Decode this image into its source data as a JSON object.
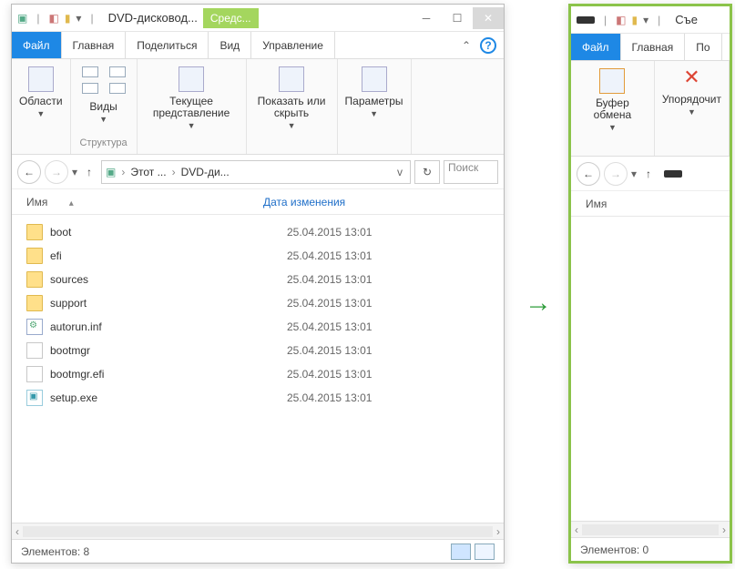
{
  "left": {
    "title": "DVD-дисковод...",
    "context_tab": "Средс...",
    "tabs": {
      "file": "Файл",
      "home": "Главная",
      "share": "Поделиться",
      "view": "Вид",
      "manage": "Управление"
    },
    "ribbon": {
      "panes": "Области",
      "views": "Виды",
      "views_group": "Структура",
      "current_view": "Текущее представление",
      "show_hide": "Показать или скрыть",
      "options": "Параметры"
    },
    "breadcrumb": {
      "seg1": "Этот ...",
      "seg2": "DVD-ди..."
    },
    "search_placeholder": "Поиск",
    "columns": {
      "name": "Имя",
      "date": "Дата изменения"
    },
    "files": [
      {
        "icon": "folder",
        "name": "boot",
        "date": "25.04.2015 13:01"
      },
      {
        "icon": "folder",
        "name": "efi",
        "date": "25.04.2015 13:01"
      },
      {
        "icon": "folder",
        "name": "sources",
        "date": "25.04.2015 13:01"
      },
      {
        "icon": "folder",
        "name": "support",
        "date": "25.04.2015 13:01"
      },
      {
        "icon": "inf",
        "name": "autorun.inf",
        "date": "25.04.2015 13:01"
      },
      {
        "icon": "blank",
        "name": "bootmgr",
        "date": "25.04.2015 13:01"
      },
      {
        "icon": "blank",
        "name": "bootmgr.efi",
        "date": "25.04.2015 13:01"
      },
      {
        "icon": "exe",
        "name": "setup.exe",
        "date": "25.04.2015 13:01"
      }
    ],
    "status": "Элементов: 8"
  },
  "right": {
    "title": "Съе",
    "tabs": {
      "file": "Файл",
      "home": "Главная",
      "share": "По"
    },
    "ribbon": {
      "clipboard": "Буфер обмена",
      "organize": "Упорядочит"
    },
    "columns": {
      "name": "Имя"
    },
    "status": "Элементов: 0"
  }
}
